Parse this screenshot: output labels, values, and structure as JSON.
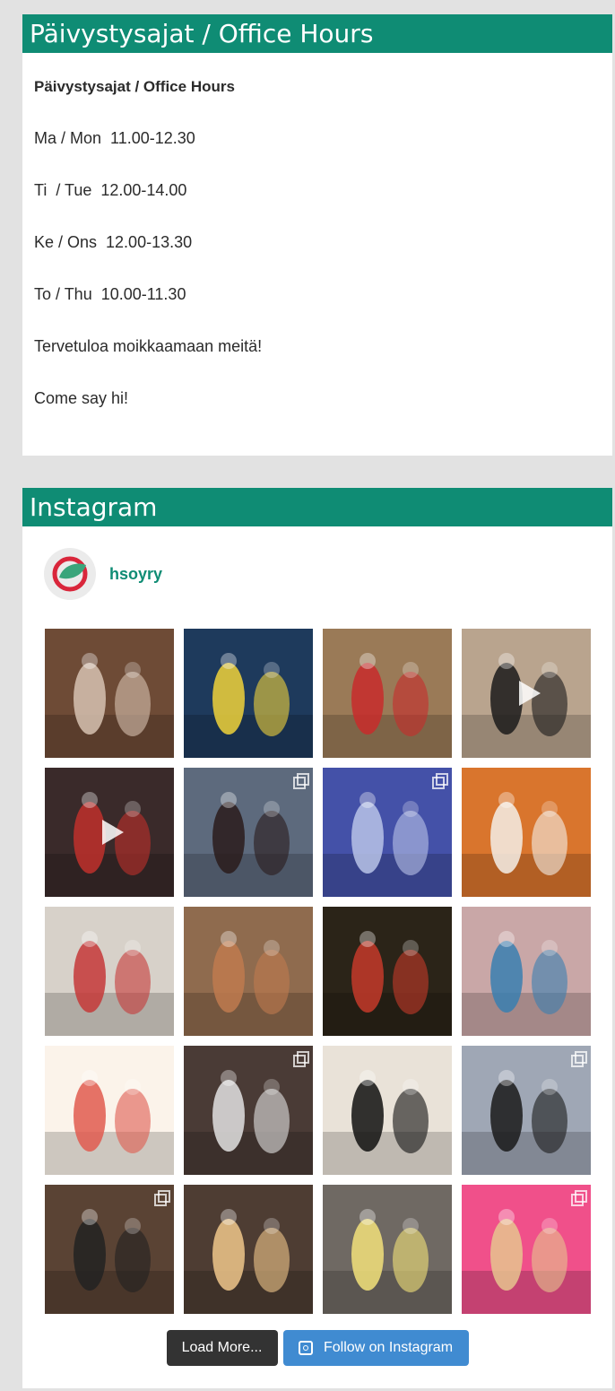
{
  "hours_widget": {
    "title": "Päivystysajat / Office Hours",
    "heading": "Päivystysajat / Office Hours",
    "lines": [
      "Ma / Mon  11.00-12.30",
      "Ti  / Tue  12.00-14.00",
      "Ke / Ons  12.00-13.30",
      "To / Thu  10.00-11.30",
      "Tervetuloa moikkaamaan meitä!",
      "Come say hi!"
    ]
  },
  "instagram": {
    "title": "Instagram",
    "username": "hsoyry",
    "load_more_label": "Load More...",
    "follow_label": "Follow on Instagram",
    "colors": {
      "accent": "#0f8c74",
      "follow_button": "#408bd1",
      "load_button": "#333333"
    },
    "posts": [
      {
        "bg": "#6e4b36",
        "accent": "#d7c2b1",
        "type": "image"
      },
      {
        "bg": "#1e3a5c",
        "accent": "#f0d23a",
        "type": "image"
      },
      {
        "bg": "#9a7a57",
        "accent": "#c82b2b",
        "type": "image"
      },
      {
        "bg": "#b9a48e",
        "accent": "#1b1b1b",
        "type": "video"
      },
      {
        "bg": "#3a2a2a",
        "accent": "#c0302b",
        "type": "video"
      },
      {
        "bg": "#5d6a7d",
        "accent": "#2a1b1b",
        "type": "gallery"
      },
      {
        "bg": "#4451a8",
        "accent": "#b9c3e8",
        "type": "gallery"
      },
      {
        "bg": "#d9752d",
        "accent": "#f3efe7",
        "type": "image"
      },
      {
        "bg": "#d7d1c9",
        "accent": "#c63838",
        "type": "image"
      },
      {
        "bg": "#8f6b4e",
        "accent": "#c07a4f",
        "type": "image"
      },
      {
        "bg": "#2b2418",
        "accent": "#c43a2a",
        "type": "image"
      },
      {
        "bg": "#c9a7a7",
        "accent": "#3a7fb0",
        "type": "image"
      },
      {
        "bg": "#fbf3ea",
        "accent": "#e05a4f",
        "type": "image"
      },
      {
        "bg": "#4a3b36",
        "accent": "#e2e2e2",
        "type": "gallery"
      },
      {
        "bg": "#e9e2d8",
        "accent": "#111111",
        "type": "image"
      },
      {
        "bg": "#9fa7b5",
        "accent": "#1a1a1a",
        "type": "gallery"
      },
      {
        "bg": "#5a4334",
        "accent": "#222222",
        "type": "gallery"
      },
      {
        "bg": "#4e3d33",
        "accent": "#f0c78b",
        "type": "image"
      },
      {
        "bg": "#6f6963",
        "accent": "#f3e27a",
        "type": "image"
      },
      {
        "bg": "#f0508a",
        "accent": "#e6c48e",
        "type": "gallery"
      }
    ]
  }
}
